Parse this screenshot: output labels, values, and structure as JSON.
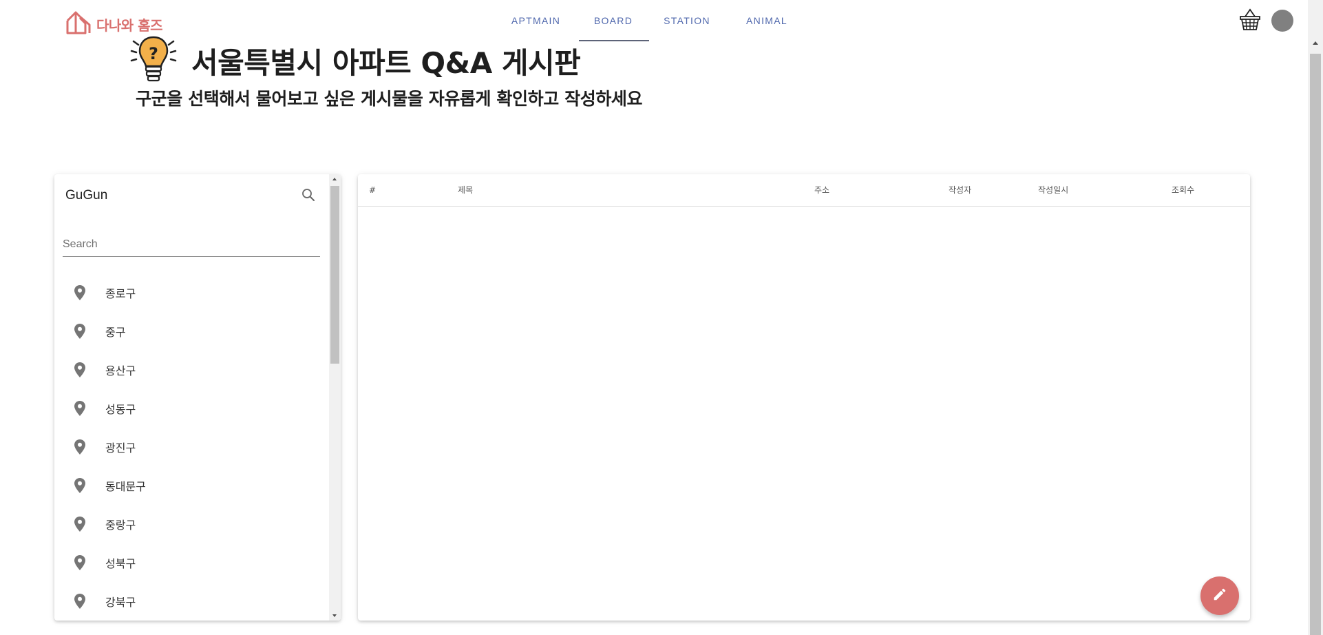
{
  "header": {
    "logo_text": "다나와 홈즈",
    "tabs": [
      {
        "label": "APTMAIN"
      },
      {
        "label": "BOARD"
      },
      {
        "label": "STATION"
      },
      {
        "label": "ANIMAL"
      }
    ],
    "active_tab": "BOARD"
  },
  "page": {
    "title": "서울특별시 아파트 Q&A 게시판",
    "subtitle": "구군을 선택해서 물어보고 싶은 게시물을 자유롭게 확인하고 작성하세요"
  },
  "gugun": {
    "title": "GuGun",
    "search_placeholder": "Search",
    "search_value": "",
    "items": [
      {
        "label": "종로구"
      },
      {
        "label": "중구"
      },
      {
        "label": "용산구"
      },
      {
        "label": "성동구"
      },
      {
        "label": "광진구"
      },
      {
        "label": "동대문구"
      },
      {
        "label": "중랑구"
      },
      {
        "label": "성북구"
      },
      {
        "label": "강북구"
      }
    ]
  },
  "table": {
    "columns": [
      "#",
      "제목",
      "주소",
      "작성자",
      "작성일시",
      "조회수"
    ],
    "rows": []
  },
  "colors": {
    "accent": "#d9706e",
    "nav_text": "#5068ad",
    "active_indicator": "#5d6378",
    "avatar": "#808080"
  },
  "icons": {
    "logo": "house-logo-icon",
    "basket": "basket-icon",
    "search": "search-icon",
    "pin": "map-pin-icon",
    "fab": "pencil-icon",
    "header": "lightbulb-question-icon"
  }
}
